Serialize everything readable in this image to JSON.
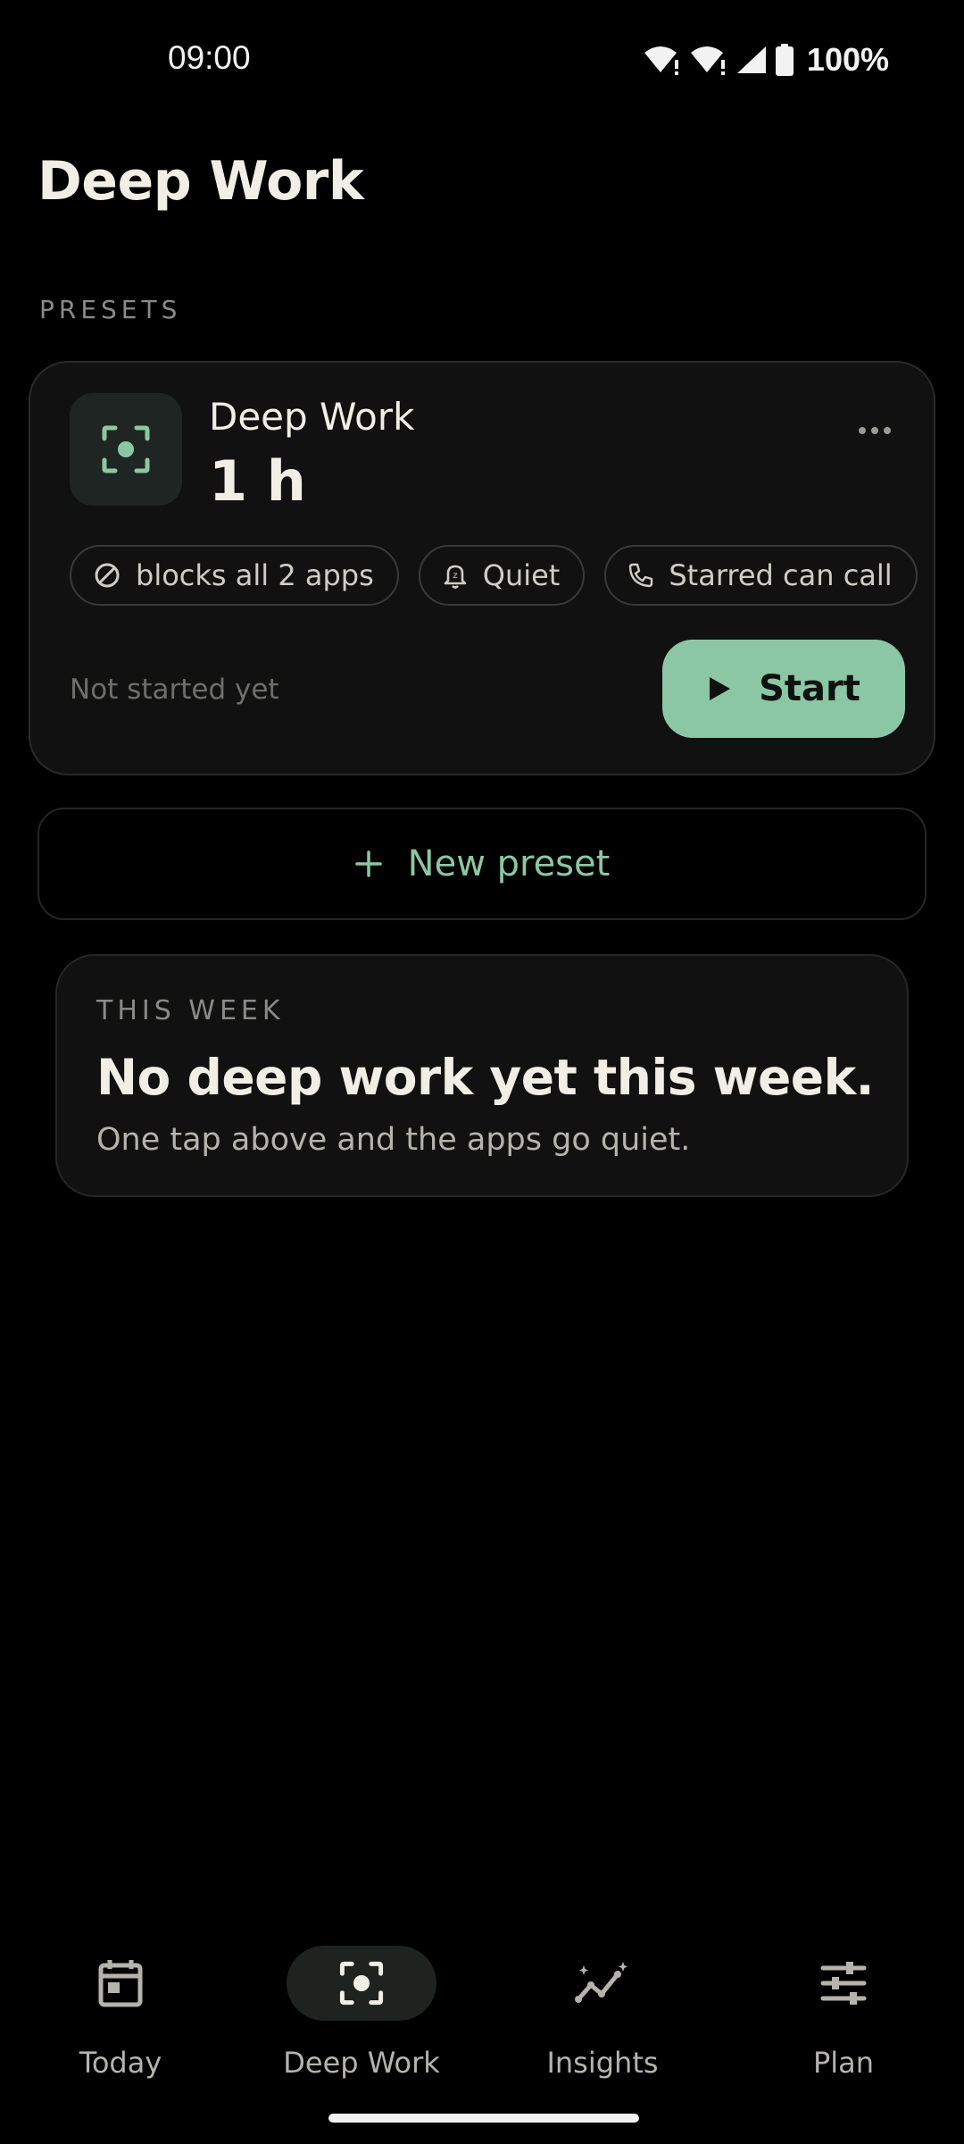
{
  "status_bar": {
    "time": "09:00",
    "battery": "100%"
  },
  "header": {
    "title": "Deep Work"
  },
  "presets_section": {
    "label": "PRESETS"
  },
  "preset": {
    "icon": "focus-icon",
    "name": "Deep Work",
    "duration": "1 h",
    "chips": [
      {
        "icon": "block-icon",
        "label": "blocks all 2 apps"
      },
      {
        "icon": "bell-icon",
        "label": "Quiet"
      },
      {
        "icon": "phone-icon",
        "label": "Starred can call"
      }
    ],
    "status_text": "Not started yet",
    "start_label": "Start"
  },
  "new_preset": {
    "label": "New preset"
  },
  "this_week": {
    "label": "THIS WEEK",
    "headline": "No deep work yet this week.",
    "subtitle": "One tap above and the apps go quiet."
  },
  "bottom_nav": {
    "items": [
      {
        "label": "Today",
        "icon": "calendar-icon",
        "active": false
      },
      {
        "label": "Deep Work",
        "icon": "focus-icon",
        "active": true
      },
      {
        "label": "Insights",
        "icon": "sparkline-icon",
        "active": false
      },
      {
        "label": "Plan",
        "icon": "sliders-icon",
        "active": false
      }
    ]
  },
  "colors": {
    "background": "#000000",
    "card": "#111111",
    "accent": "#8CC7A5",
    "text_primary": "#F1EEE6",
    "text_muted": "#8A8A86"
  }
}
